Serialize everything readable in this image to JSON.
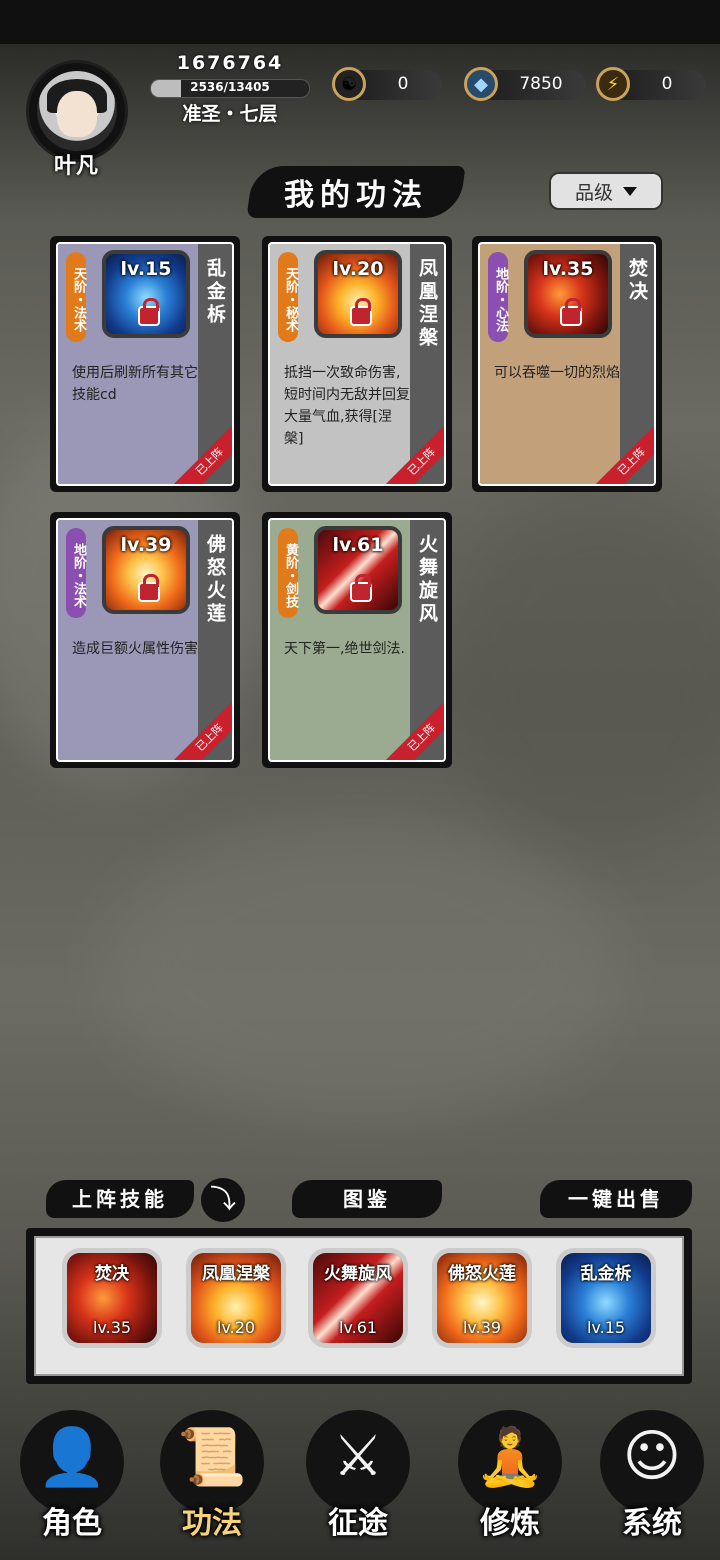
{
  "header": {
    "player_name": "叶凡",
    "power": "1676764",
    "exp_text": "2536/13405",
    "exp_fraction": 0.189,
    "realm": "准圣・七层",
    "resources": [
      {
        "icon": "yin-yang-icon",
        "value": "0"
      },
      {
        "icon": "spirit-stone-icon",
        "value": "7850"
      },
      {
        "icon": "lightning-icon",
        "value": "0"
      }
    ]
  },
  "page_title": "我的功法",
  "sort": {
    "label": "品级"
  },
  "cards": [
    {
      "grade": "天阶・法术",
      "grade_color": "#e07a1a",
      "level": "lv.15",
      "name": "乱金柝",
      "desc": "使用后刷新所有其它技能cd",
      "bg": "#9a98b6",
      "ribbon": "已上阵",
      "art": "blue-hex"
    },
    {
      "grade": "天阶・秘术",
      "grade_color": "#e07a1a",
      "level": "lv.20",
      "name": "凤凰涅槃",
      "desc": "抵挡一次致命伤害,短时间内无敌并回复大量气血,获得[涅槃]",
      "bg": "#c2c2c2",
      "ribbon": "已上阵",
      "art": "phoenix"
    },
    {
      "grade": "地阶・心法",
      "grade_color": "#8a4fb0",
      "level": "lv.35",
      "name": "焚决",
      "desc": "可以吞噬一切的烈焰",
      "bg": "#c1a07a",
      "ribbon": "已上阵",
      "art": "flame"
    },
    {
      "grade": "地阶・法术",
      "grade_color": "#8a4fb0",
      "level": "lv.39",
      "name": "佛怒火莲",
      "desc": "造成巨额火属性伤害",
      "bg": "#9a98b6",
      "ribbon": "已上阵",
      "art": "lotus"
    },
    {
      "grade": "黄阶・剑技",
      "grade_color": "#e07a1a",
      "level": "lv.61",
      "name": "火舞旋风",
      "desc": "天下第一,绝世剑法.",
      "bg": "#9bab92",
      "ribbon": "已上阵",
      "art": "sword"
    }
  ],
  "bottom": {
    "deployed_label": "上阵技能",
    "collection_label": "图鉴",
    "sell_label": "一键出售",
    "slots": [
      {
        "name": "焚决",
        "level": "lv.35",
        "art": "flame"
      },
      {
        "name": "凤凰涅槃",
        "level": "lv.20",
        "art": "phoenix"
      },
      {
        "name": "火舞旋风",
        "level": "lv.61",
        "art": "sword"
      },
      {
        "name": "佛怒火莲",
        "level": "lv.39",
        "art": "lotus"
      },
      {
        "name": "乱金柝",
        "level": "lv.15",
        "art": "blue-hex"
      }
    ]
  },
  "nav": [
    {
      "label": "角色",
      "icon": "hooded-figure-icon"
    },
    {
      "label": "功法",
      "icon": "scroll-book-icon"
    },
    {
      "label": "征途",
      "icon": "sword-emblem-icon"
    },
    {
      "label": "修炼",
      "icon": "meditation-icon"
    },
    {
      "label": "系统",
      "icon": "mascot-face-icon"
    }
  ]
}
